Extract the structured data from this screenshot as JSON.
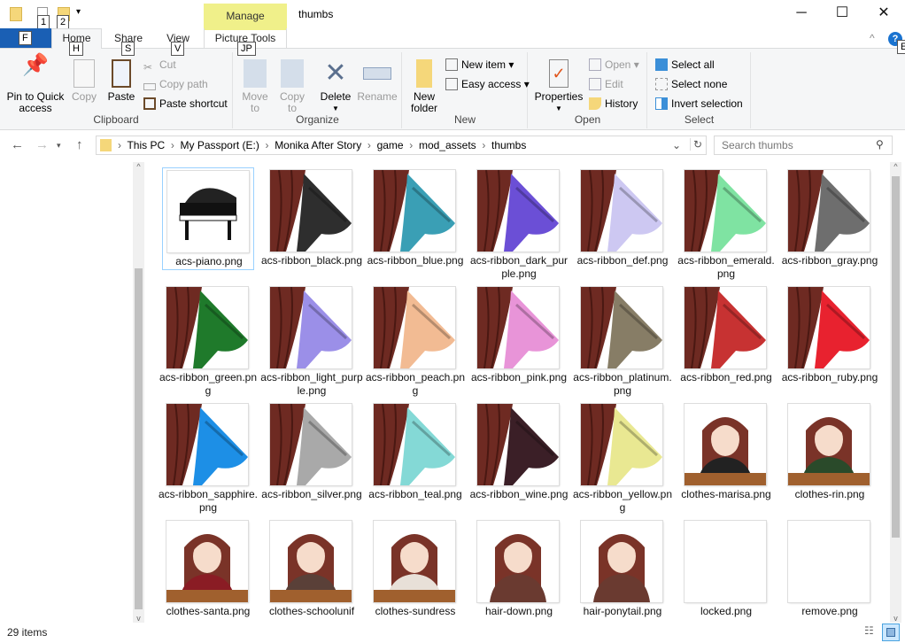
{
  "window": {
    "title": "thumbs",
    "context_tab": "Manage",
    "keytips": [
      "1",
      "2",
      "F",
      "H",
      "S",
      "V",
      "JP",
      "E"
    ]
  },
  "tabs": [
    {
      "label": "Home"
    },
    {
      "label": "Share"
    },
    {
      "label": "View"
    },
    {
      "label": "Picture Tools"
    }
  ],
  "ribbon": {
    "clipboard": {
      "label": "Clipboard",
      "pin": "Pin to Quick access",
      "pin1": "Pin to Quick",
      "pin2": "access",
      "copy": "Copy",
      "paste": "Paste",
      "cut": "Cut",
      "copy_path": "Copy path",
      "paste_shortcut": "Paste shortcut"
    },
    "organize": {
      "label": "Organize",
      "move1": "Move",
      "move2": "to",
      "copy1": "Copy",
      "copy2": "to",
      "delete": "Delete",
      "rename": "Rename"
    },
    "new": {
      "label": "New",
      "folder1": "New",
      "folder2": "folder",
      "new_item": "New item",
      "easy_access": "Easy access"
    },
    "open": {
      "label": "Open",
      "properties": "Properties",
      "open": "Open",
      "edit": "Edit",
      "history": "History"
    },
    "select": {
      "label": "Select",
      "all": "Select all",
      "none": "Select none",
      "invert": "Invert selection"
    }
  },
  "address": {
    "crumbs": [
      "This PC",
      "My Passport (E:)",
      "Monika After Story",
      "game",
      "mod_assets",
      "thumbs"
    ],
    "search_placeholder": "Search thumbs"
  },
  "files": [
    {
      "name": "acs-piano.png",
      "kind": "piano",
      "selected": true
    },
    {
      "name": "acs-ribbon_black.png",
      "color": "#2e2e2e"
    },
    {
      "name": "acs-ribbon_blue.png",
      "color": "#3a9fb5"
    },
    {
      "name": "acs-ribbon_dark_purple.png",
      "color": "#6b4fd6"
    },
    {
      "name": "acs-ribbon_def.png",
      "color": "#cdc8f2"
    },
    {
      "name": "acs-ribbon_emerald.png",
      "color": "#7fe3a2"
    },
    {
      "name": "acs-ribbon_gray.png",
      "color": "#6e6e6e"
    },
    {
      "name": "acs-ribbon_green.png",
      "color": "#1f7a2b"
    },
    {
      "name": "acs-ribbon_light_purple.png",
      "color": "#9b8fe8"
    },
    {
      "name": "acs-ribbon_peach.png",
      "color": "#f2bb93"
    },
    {
      "name": "acs-ribbon_pink.png",
      "color": "#e894d8"
    },
    {
      "name": "acs-ribbon_platinum.png",
      "color": "#877d66"
    },
    {
      "name": "acs-ribbon_red.png",
      "color": "#c73232"
    },
    {
      "name": "acs-ribbon_ruby.png",
      "color": "#e8222f"
    },
    {
      "name": "acs-ribbon_sapphire.png",
      "color": "#1d8fe6"
    },
    {
      "name": "acs-ribbon_silver.png",
      "color": "#a9a9a9"
    },
    {
      "name": "acs-ribbon_teal.png",
      "color": "#84d9d6"
    },
    {
      "name": "acs-ribbon_wine.png",
      "color": "#3b1f27"
    },
    {
      "name": "acs-ribbon_yellow.png",
      "color": "#e9e892"
    },
    {
      "name": "clothes-marisa.png",
      "kind": "portrait",
      "color": "#222222"
    },
    {
      "name": "clothes-rin.png",
      "kind": "portrait",
      "color": "#2a4a2a"
    },
    {
      "name": "clothes-santa.png",
      "kind": "portrait",
      "color": "#8a1c24"
    },
    {
      "name": "clothes-schoolunif",
      "kind": "portrait",
      "color": "#5a4038"
    },
    {
      "name": "clothes-sundress",
      "kind": "portrait",
      "color": "#e8e0d8"
    },
    {
      "name": "hair-down.png",
      "kind": "face",
      "color": "#6a3a30"
    },
    {
      "name": "hair-ponytail.png",
      "kind": "face",
      "color": "#6a3a30"
    },
    {
      "name": "locked.png",
      "kind": "blank"
    },
    {
      "name": "remove.png",
      "kind": "blank"
    }
  ],
  "status": {
    "count": "29 items"
  }
}
